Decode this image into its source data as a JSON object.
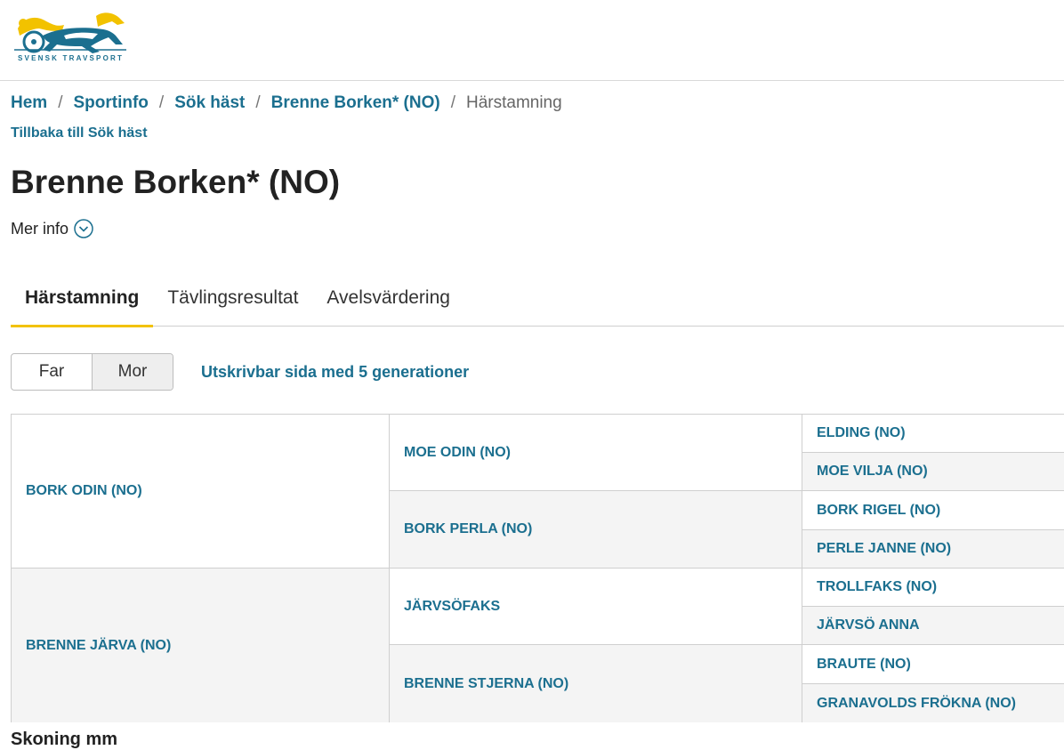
{
  "header": {
    "logo_text": "SVENSK TRAVSPORT"
  },
  "breadcrumb": {
    "items": [
      "Hem",
      "Sportinfo",
      "Sök häst",
      "Brenne Borken* (NO)"
    ],
    "current": "Härstamning"
  },
  "back_link": "Tillbaka till Sök häst",
  "page_title": "Brenne Borken* (NO)",
  "mer_info": "Mer info",
  "tabs": [
    {
      "label": "Härstamning",
      "active": true
    },
    {
      "label": "Tävlingsresultat",
      "active": false
    },
    {
      "label": "Avelsvärdering",
      "active": false
    }
  ],
  "toggle": {
    "far": "Far",
    "mor": "Mor",
    "selected": "Mor"
  },
  "print_link": "Utskrivbar sida med 5 generationer",
  "pedigree": {
    "gen1": [
      "BORK ODIN (NO)",
      "BRENNE JÄRVA (NO)"
    ],
    "gen2": [
      "MOE ODIN (NO)",
      "BORK PERLA (NO)",
      "JÄRVSÖFAKS",
      "BRENNE STJERNA (NO)"
    ],
    "gen3": [
      "ELDING (NO)",
      "MOE VILJA (NO)",
      "BORK RIGEL (NO)",
      "PERLE JANNE (NO)",
      "TROLLFAKS (NO)",
      "JÄRVSÖ ANNA",
      "BRAUTE (NO)",
      "GRANAVOLDS FRÖKNA (NO)"
    ]
  },
  "next_heading": "Skoning mm",
  "colors": {
    "link": "#1b6f8f",
    "accent": "#f2c200",
    "shade": "#f4f4f4"
  }
}
